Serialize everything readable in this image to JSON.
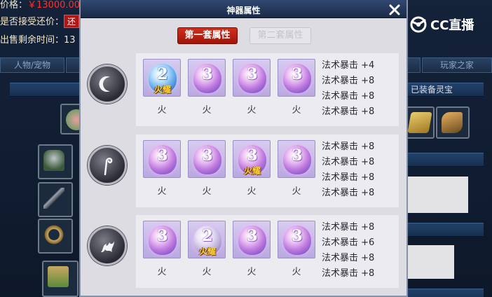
{
  "background": {
    "line1_prefix": "价格：",
    "line1_value": "￥13000.00",
    "line2_label": "是否接受还价：",
    "line2_button": "还",
    "line3_label": "出售剩余时间：",
    "line3_value": "13",
    "tab_left": "人物/宠物",
    "tab_right": "玩家之家",
    "equipped_label": "已装备灵宝"
  },
  "brand": {
    "logo_text": "CC直播"
  },
  "modal": {
    "title": "神器属性",
    "tabs": [
      {
        "label": "第一套属性",
        "active": true
      },
      {
        "label": "第二套属性",
        "active": false
      }
    ],
    "rows": [
      {
        "badge_icon": "crescent-moon-icon",
        "gems": [
          {
            "level": "2",
            "color": "blue",
            "tag": "火耀",
            "element": "火"
          },
          {
            "level": "3",
            "color": "purple",
            "tag": "",
            "element": "火"
          },
          {
            "level": "3",
            "color": "purple",
            "tag": "",
            "element": "火"
          },
          {
            "level": "3",
            "color": "purple",
            "tag": "",
            "element": "火"
          }
        ],
        "stats": [
          "法术暴击 +4",
          "法术暴击 +8",
          "法术暴击 +8",
          "法术暴击 +8"
        ]
      },
      {
        "badge_icon": "hook-staff-icon",
        "gems": [
          {
            "level": "3",
            "color": "purple",
            "tag": "",
            "element": "火"
          },
          {
            "level": "3",
            "color": "purple",
            "tag": "",
            "element": "火"
          },
          {
            "level": "3",
            "color": "purple",
            "tag": "火耀",
            "element": "火"
          },
          {
            "level": "3",
            "color": "purple",
            "tag": "",
            "element": "火"
          }
        ],
        "stats": [
          "法术暴击 +8",
          "法术暴击 +8",
          "法术暴击 +8",
          "法术暴击 +8"
        ]
      },
      {
        "badge_icon": "flame-sprite-icon",
        "gems": [
          {
            "level": "3",
            "color": "purple",
            "tag": "",
            "element": "火"
          },
          {
            "level": "2",
            "color": "pale",
            "tag": "火耀",
            "element": "火"
          },
          {
            "level": "3",
            "color": "purple",
            "tag": "",
            "element": "火"
          },
          {
            "level": "3",
            "color": "purple",
            "tag": "",
            "element": "火"
          }
        ],
        "stats": [
          "法术暴击 +8",
          "法术暴击 +6",
          "法术暴击 +8",
          "法术暴击 +8"
        ]
      }
    ]
  }
}
